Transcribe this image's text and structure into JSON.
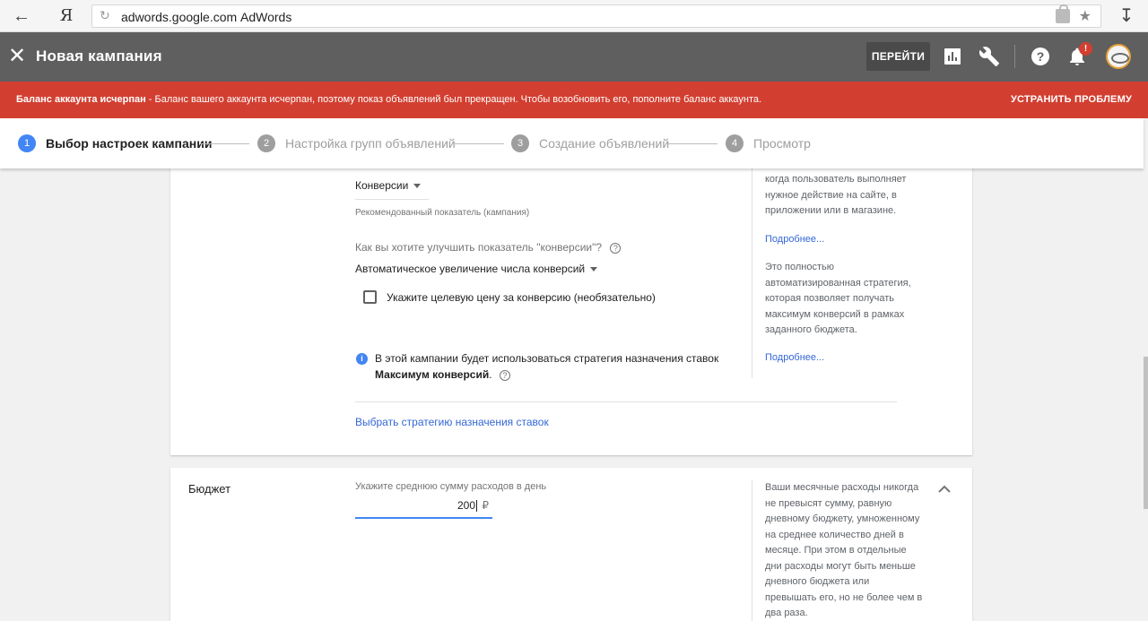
{
  "browser": {
    "yandex_label": "Я",
    "host": "adwords.google.com",
    "title": "AdWords"
  },
  "header": {
    "title": "Новая кампания",
    "goto_label": "ПЕРЕЙТИ",
    "notification_badge": "!"
  },
  "alert": {
    "strong": "Баланс аккаунта исчерпан",
    "text": " - Баланс вашего аккаунта исчерпан, поэтому показ объявлений был прекращен. Чтобы возобновить его, пополните баланс аккаунта.",
    "fix_label": "УСТРАНИТЬ ПРОБЛЕМУ",
    "color": "#d23f31"
  },
  "stepper": {
    "steps": [
      {
        "num": "1",
        "label": "Выбор настроек кампании"
      },
      {
        "num": "2",
        "label": "Настройка групп объявлений"
      },
      {
        "num": "3",
        "label": "Создание объявлений"
      },
      {
        "num": "4",
        "label": "Просмотр"
      }
    ],
    "active_color": "#4285f4"
  },
  "bidding": {
    "metric_value": "Конверсии",
    "metric_hint": "Рекомендованный показатель (кампания)",
    "improve_question": "Как вы хотите улучшить показатель \"конверсии\"?",
    "improve_value": "Автоматическое увеличение числа конверсий",
    "target_cpa_label": "Укажите целевую цену за конверсию (необязательно)",
    "info_text": "В этой кампании будет использоваться стратегия назначения ставок",
    "info_strategy": "Максимум конверсий",
    "info_period": ".",
    "select_strategy_link": "Выбрать стратегию назначения ставок",
    "side_text_1": "когда пользователь выполняет нужное действие на сайте, в приложении или в магазине.",
    "side_link_1": "Подробнее...",
    "side_text_2": "Это полностью автоматизированная стратегия, которая позволяет получать максимум конверсий в рамках заданного бюджета.",
    "side_link_2": "Подробнее..."
  },
  "budget": {
    "title": "Бюджет",
    "field_label": "Укажите среднюю сумму расходов в день",
    "value": "200",
    "currency": "₽",
    "side_text": "Ваши месячные расходы никогда не превысят сумму, равную дневному бюджету, умноженному на среднее количество дней в месяце. При этом в отдельные дни расходы могут быть меньше дневного бюджета или превышать его, но не более чем в два раза."
  }
}
